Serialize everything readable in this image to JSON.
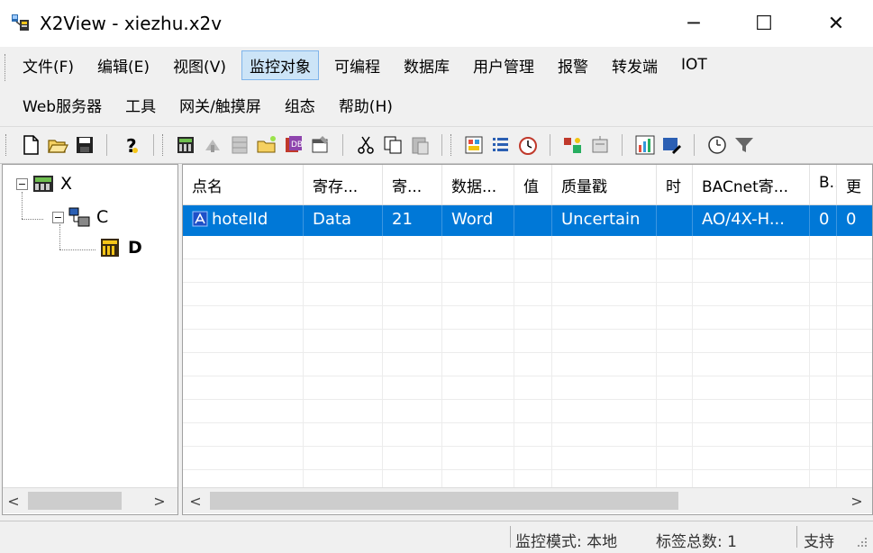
{
  "window": {
    "title": "X2View - xiezhu.x2v",
    "minimize_glyph": "─",
    "maximize_glyph": "☐",
    "close_glyph": "✕"
  },
  "menu": {
    "row1": [
      "文件(F)",
      "编辑(E)",
      "视图(V)",
      "监控对象",
      "可编程",
      "数据库",
      "用户管理",
      "报警",
      "转发端",
      "IOT"
    ],
    "row2": [
      "Web服务器",
      "工具",
      "网关/触摸屏",
      "组态",
      "帮助(H)"
    ],
    "active": "监控对象"
  },
  "toolbar": {
    "icons": [
      "new-file-icon",
      "open-folder-icon",
      "save-icon",
      "help-icon",
      "device-icon",
      "run-icon",
      "grid-icon",
      "new-folder-icon",
      "db-icon",
      "properties-icon",
      "cut-icon",
      "copy-icon",
      "paste-icon",
      "monitor-icon",
      "list-icon",
      "timer-icon",
      "network-icon",
      "report-icon",
      "chart-icon",
      "edit-icon",
      "history-icon",
      "filter-icon"
    ]
  },
  "tree": {
    "root": {
      "label": "X",
      "expander": "−"
    },
    "child": {
      "label": "C",
      "expander": "−"
    },
    "leaf": {
      "label": "D"
    }
  },
  "grid": {
    "columns": [
      "点名",
      "寄存...",
      "寄...",
      "数据...",
      "值",
      "质量戳",
      "时",
      "BACnet寄...",
      "B..",
      "更"
    ],
    "rows": [
      [
        "hotelId",
        "Data",
        "21",
        "Word",
        "",
        "Uncertain",
        "",
        "AO/4X-H...",
        "0",
        "0"
      ]
    ]
  },
  "scroll": {
    "left_arrow": "<",
    "right_arrow": ">"
  },
  "status": {
    "mode": "监控模式: 本地",
    "tag_count": "标签总数: 1",
    "support": "支持"
  },
  "colors": {
    "selection": "#0078d7",
    "menu_active_bg": "#cce4f7",
    "chrome": "#f0f0f0"
  }
}
